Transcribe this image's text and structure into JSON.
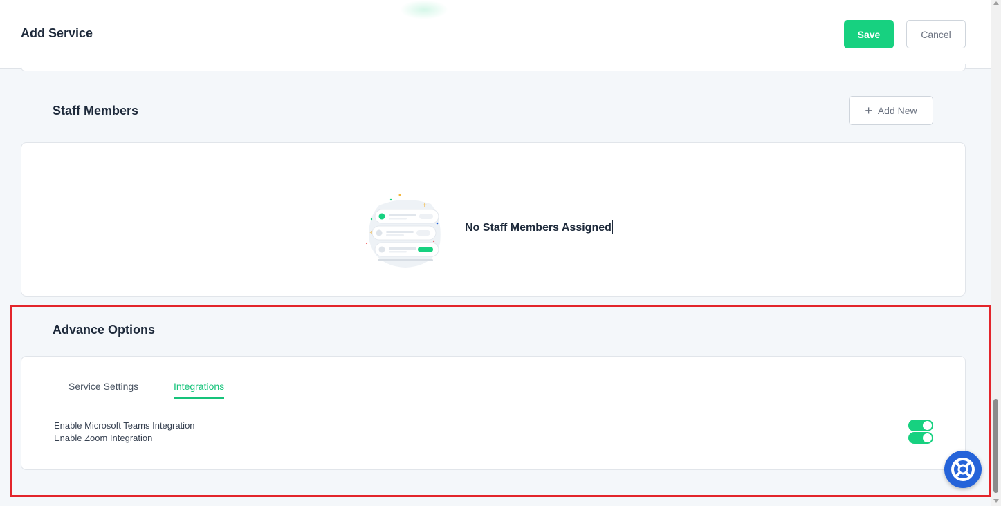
{
  "header": {
    "title": "Add Service",
    "save_label": "Save",
    "cancel_label": "Cancel"
  },
  "staff": {
    "title": "Staff Members",
    "add_new_label": "Add New",
    "empty_message": "No Staff Members Assigned"
  },
  "advance": {
    "title": "Advance Options",
    "tabs": [
      {
        "label": "Service Settings",
        "active": false
      },
      {
        "label": "Integrations",
        "active": true
      }
    ],
    "options": [
      {
        "label": "Enable Microsoft Teams Integration",
        "enabled": true
      },
      {
        "label": "Enable Zoom Integration",
        "enabled": true
      }
    ]
  },
  "icons": {
    "add": "plus-icon",
    "help": "lifebuoy-icon",
    "illustration": "empty-list-illustration"
  },
  "colors": {
    "primary": "#17d180",
    "highlight": "#e3252b",
    "help_button": "#2563d9"
  }
}
